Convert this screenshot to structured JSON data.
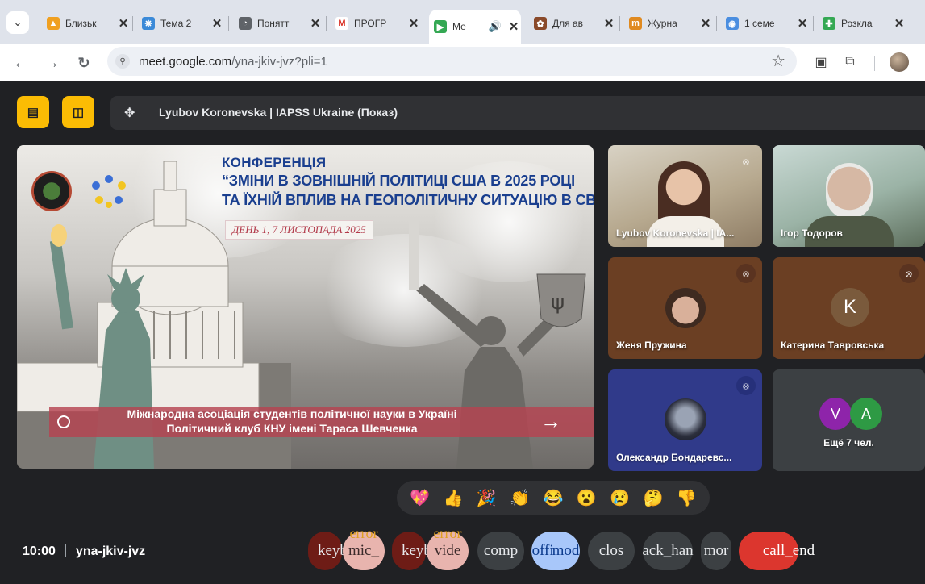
{
  "browser": {
    "tabs": [
      {
        "label": "Близьк",
        "color": "#f0a020",
        "glyph": "▲"
      },
      {
        "label": "Тема 2",
        "color": "#3b8ad8",
        "glyph": "❋"
      },
      {
        "label": "Понятт",
        "color": "#5f6368",
        "glyph": "◔"
      },
      {
        "label": "ПРОГР",
        "color": "#d93025",
        "glyph": "M"
      },
      {
        "label": "Ме",
        "color": "#34a853",
        "glyph": "▶"
      },
      {
        "label": "Для ав",
        "color": "#8a4a2a",
        "glyph": "✿"
      },
      {
        "label": "Журна",
        "color": "#e08a20",
        "glyph": "m"
      },
      {
        "label": "1 семе",
        "color": "#4a8ee0",
        "glyph": "◉"
      },
      {
        "label": "Розкла",
        "color": "#34a853",
        "glyph": "✚"
      }
    ],
    "url_main": "meet.google.com",
    "url_rest": "/yna-jkiv-jvz?pli=1"
  },
  "meet": {
    "presenter_label": "Lyubov Koronevska | IAPSS Ukraine (Показ)",
    "slide": {
      "title_line1": "КОНФЕРЕНЦІЯ",
      "title_line2": "“ЗМІНИ В ЗОВНІШНІЙ ПОЛІТИЦІ США В 2025 РОЦІ",
      "title_line3": "ТА ЇХНІЙ ВПЛИВ НА ГЕОПОЛІТИЧНУ СИТУАЦІЮ В СВІТІ”",
      "date": "ДЕНЬ 1, 7 ЛИСТОПАДА 2025",
      "banner_line1": "Міжнародна асоціація студентів політичної науки в Україні",
      "banner_line2": "Політичний клуб КНУ імені Тараса Шевченка",
      "arrow": "→"
    },
    "participants": [
      {
        "name": "Lyubov Koronevska | IA...",
        "muted": true
      },
      {
        "name": "Ігор Тодоров",
        "muted": false
      },
      {
        "name": "Женя Пружина",
        "muted": true
      },
      {
        "name": "Катерина Тавровська",
        "muted": true,
        "initial": "K"
      },
      {
        "name": "Олександр Бондаревс...",
        "muted": true
      },
      {
        "name": "Ещё 7 чел.",
        "initials": [
          "V",
          "A"
        ]
      }
    ],
    "reactions": [
      "💖",
      "👍",
      "🎉",
      "👏",
      "😂",
      "😮",
      "😢",
      "🤔",
      "👎"
    ],
    "time": "10:00",
    "meeting_code": "yna-jkiv-jvz",
    "controls": {
      "keyboard1": "keyb",
      "mic": "mic_",
      "keyboard2": "keyb",
      "video": "vide",
      "error": "error",
      "present": "comp",
      "offer": "offi",
      "closed": "mod",
      "captions": "clos",
      "hand": "ack_han",
      "more": "mor",
      "end": "call_end"
    }
  }
}
